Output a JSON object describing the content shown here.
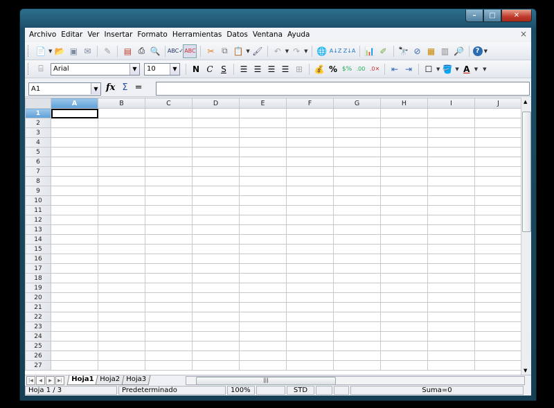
{
  "menu": [
    "Archivo",
    "Editar",
    "Ver",
    "Insertar",
    "Formato",
    "Herramientas",
    "Datos",
    "Ventana",
    "Ayuda"
  ],
  "toolbar2": {
    "font_name": "Arial",
    "font_size": "10",
    "bold": "N",
    "italic": "C",
    "underline": "S"
  },
  "formula": {
    "cell_ref": "A1",
    "fx": "fx",
    "sum": "Σ",
    "equals": "=",
    "value": ""
  },
  "columns": [
    "A",
    "B",
    "C",
    "D",
    "E",
    "F",
    "G",
    "H",
    "I",
    "J"
  ],
  "rows": [
    "1",
    "2",
    "3",
    "4",
    "5",
    "6",
    "7",
    "8",
    "9",
    "10",
    "11",
    "12",
    "13",
    "14",
    "15",
    "16",
    "17",
    "18",
    "19",
    "20",
    "21",
    "22",
    "23",
    "24",
    "25",
    "26",
    "27"
  ],
  "selected_cell": "A1",
  "tabs": [
    "Hoja1",
    "Hoja2",
    "Hoja3"
  ],
  "active_tab": "Hoja1",
  "status": {
    "sheet": "Hoja 1 / 3",
    "style": "Predeterminado",
    "zoom": "100%",
    "mode": "STD",
    "sum": "Suma=0"
  },
  "colors": {
    "selection": "#5d9fd8",
    "titlebar": "#1b4c66",
    "close": "#c0392b"
  }
}
